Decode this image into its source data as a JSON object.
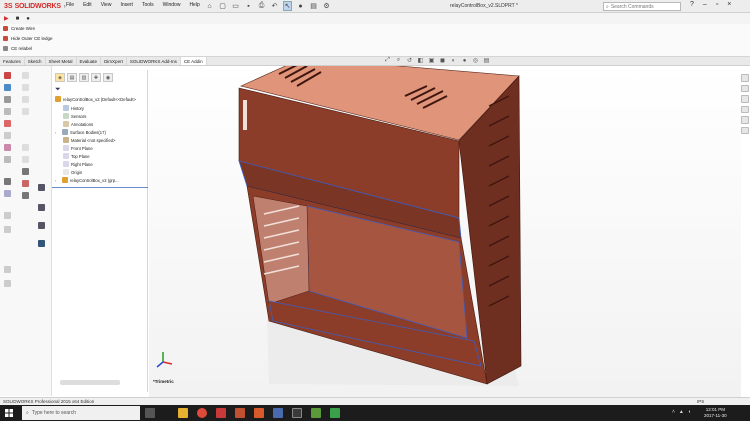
{
  "titlebar": {
    "brand_ds": "3S",
    "brand_name": "SOLIDWORKS",
    "menus": [
      "File",
      "Edit",
      "View",
      "Insert",
      "Tools",
      "Window",
      "Help"
    ],
    "document_title": "relayControlBox_v2.SLDPRT *",
    "search_placeholder": "Search Commands"
  },
  "command_row": {
    "play": "▶",
    "stop": "■",
    "rec": "●"
  },
  "commands": {
    "create_wire": "Create Wire",
    "hide_outer": "Hide Outer CE ledge",
    "third": "CE relabel"
  },
  "tabs": [
    "Features",
    "Sketch",
    "Sheet Metal",
    "Evaluate",
    "DimXpert",
    "SOLIDWORKS Add-Ins",
    "CE Addin"
  ],
  "active_tab": 6,
  "tree": {
    "root": "relayControlBox_v2 (Default<<Default>",
    "items": [
      "History",
      "Sensors",
      "Annotations",
      "Surface Bodies(17)",
      "Material <not specified>",
      "Front Plane",
      "Top Plane",
      "Right Plane",
      "Origin",
      "relayControlBox_v2 (grp..."
    ]
  },
  "viewport": {
    "view_label": "*Trimetric"
  },
  "statusbar": {
    "left": "SOLIDWORKS Professional 2015 x64 Edition",
    "right": "IPS"
  },
  "taskbar": {
    "search_placeholder": "Type here to search",
    "time": "12:01 PM",
    "date": "2017-11-30"
  },
  "colors": {
    "model_top": "#e0957a",
    "model_body": "#8b3d2a",
    "model_side": "#6e2f20",
    "edge_blue": "#3a5fc8",
    "brand_red": "#d42a2a"
  }
}
